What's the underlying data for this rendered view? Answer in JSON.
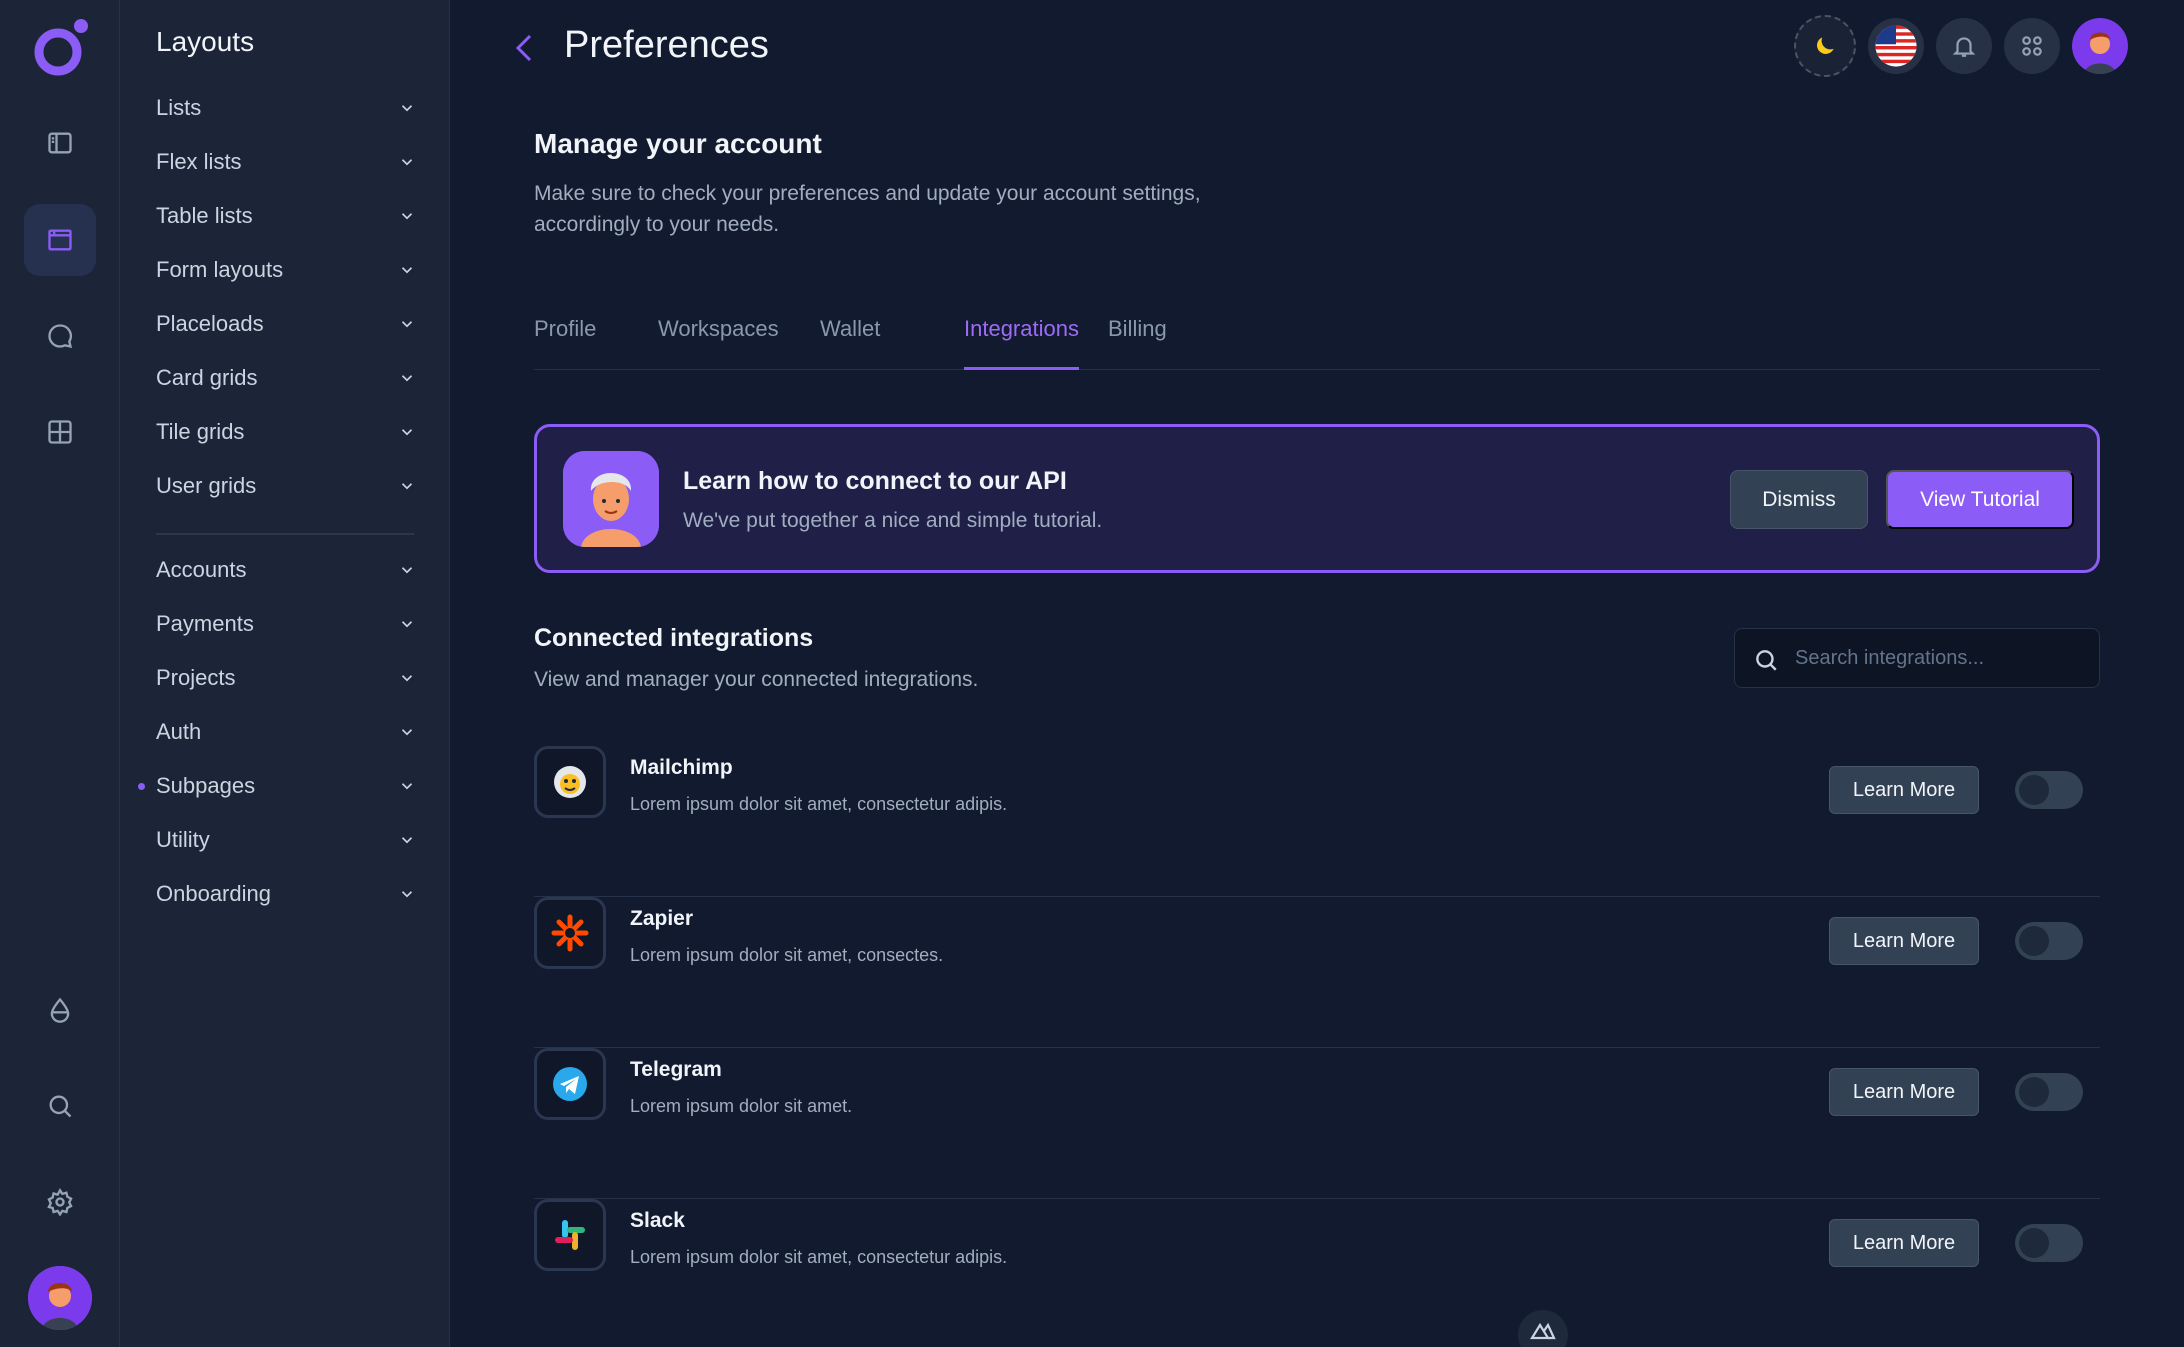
{
  "sidebar": {
    "title": "Layouts",
    "items": [
      {
        "label": "Lists"
      },
      {
        "label": "Flex lists"
      },
      {
        "label": "Table lists"
      },
      {
        "label": "Form layouts"
      },
      {
        "label": "Placeloads"
      },
      {
        "label": "Card grids"
      },
      {
        "label": "Tile grids"
      },
      {
        "label": "User grids"
      },
      {
        "label": "Accounts"
      },
      {
        "label": "Payments"
      },
      {
        "label": "Projects"
      },
      {
        "label": "Auth"
      },
      {
        "label": "Subpages"
      },
      {
        "label": "Utility"
      },
      {
        "label": "Onboarding"
      }
    ]
  },
  "header": {
    "title": "Preferences"
  },
  "account": {
    "title": "Manage your account",
    "description": "Make sure to check your preferences and update your account settings, accordingly to your needs."
  },
  "tabs": [
    {
      "label": "Profile"
    },
    {
      "label": "Workspaces"
    },
    {
      "label": "Wallet"
    },
    {
      "label": "Integrations"
    },
    {
      "label": "Billing"
    }
  ],
  "banner": {
    "title": "Learn how to connect to our API",
    "subtitle": "We've put together a nice and simple tutorial.",
    "dismiss_label": "Dismiss",
    "tutorial_label": "View Tutorial"
  },
  "integrations": {
    "title": "Connected integrations",
    "description": "View and manager your connected integrations.",
    "search_placeholder": "Search integrations...",
    "learn_more_label": "Learn More",
    "items": [
      {
        "name": "Mailchimp",
        "description": "Lorem ipsum dolor sit amet, consectetur adipis.",
        "icon": "mailchimp-icon",
        "enabled": false
      },
      {
        "name": "Zapier",
        "description": "Lorem ipsum dolor sit amet, consectes.",
        "icon": "zapier-icon",
        "enabled": false
      },
      {
        "name": "Telegram",
        "description": "Lorem ipsum dolor sit amet.",
        "icon": "telegram-icon",
        "enabled": false
      },
      {
        "name": "Slack",
        "description": "Lorem ipsum dolor sit amet, consectetur adipis.",
        "icon": "slack-icon",
        "enabled": false
      }
    ]
  },
  "colors": {
    "accent": "#8b5cf6",
    "background": "#111a2e",
    "sidebar": "#1c2537"
  }
}
